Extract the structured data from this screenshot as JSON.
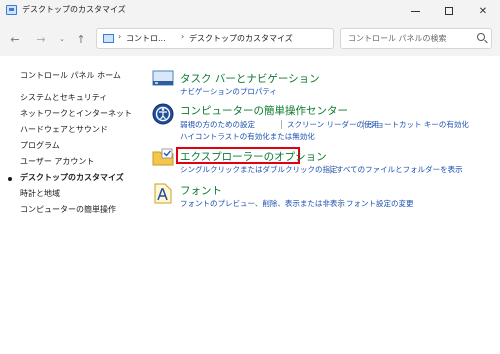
{
  "window": {
    "title": "デスクトップのカスタマイズ",
    "minimize_icon": "minimize-icon",
    "maximize_icon": "maximize-icon",
    "close_label": "✕"
  },
  "navigation": {
    "back": "←",
    "forward": "→",
    "recent": "⌄",
    "up": "↑",
    "address": {
      "crumbs": [
        "コントロ...",
        "デスクトップのカスタマイズ"
      ],
      "separator": "›",
      "dropdown": "⌄",
      "refresh": "↻"
    },
    "search_placeholder": "コントロール パネルの検索"
  },
  "sidebar": {
    "items": [
      {
        "label": "コントロール パネル ホーム"
      },
      {
        "label": "システムとセキュリティ"
      },
      {
        "label": "ネットワークとインターネット"
      },
      {
        "label": "ハードウェアとサウンド"
      },
      {
        "label": "プログラム"
      },
      {
        "label": "ユーザー アカウント"
      },
      {
        "label": "デスクトップのカスタマイズ",
        "active": true
      },
      {
        "label": "時計と地域"
      },
      {
        "label": "コンピューターの簡単操作"
      }
    ]
  },
  "categories": [
    {
      "title": "タスク バーとナビゲーション",
      "icon": "taskbar-icon",
      "links": [
        "ナビゲーションのプロパティ"
      ]
    },
    {
      "title": "コンピューターの簡単操作センター",
      "icon": "ease-of-access-icon",
      "links": [
        "弱視の方のための設定",
        "スクリーン リーダーの使用",
        "ショートカット キーの有効化",
        "ハイコントラストの有効化または無効化"
      ]
    },
    {
      "title": "エクスプローラーのオプション",
      "icon": "folder-options-icon",
      "highlighted": true,
      "highlight_color": "#e00012",
      "links": [
        "シングルクリックまたはダブルクリックの指定",
        "すべてのファイルとフォルダーを表示"
      ]
    },
    {
      "title": "フォント",
      "icon": "fonts-icon",
      "links": [
        "フォントのプレビュー、削除、表示または非表示",
        "フォント設定の変更"
      ]
    }
  ],
  "colors": {
    "category_title": "#0a7a2c",
    "link": "#1a4fb0",
    "highlight": "#e00012"
  }
}
